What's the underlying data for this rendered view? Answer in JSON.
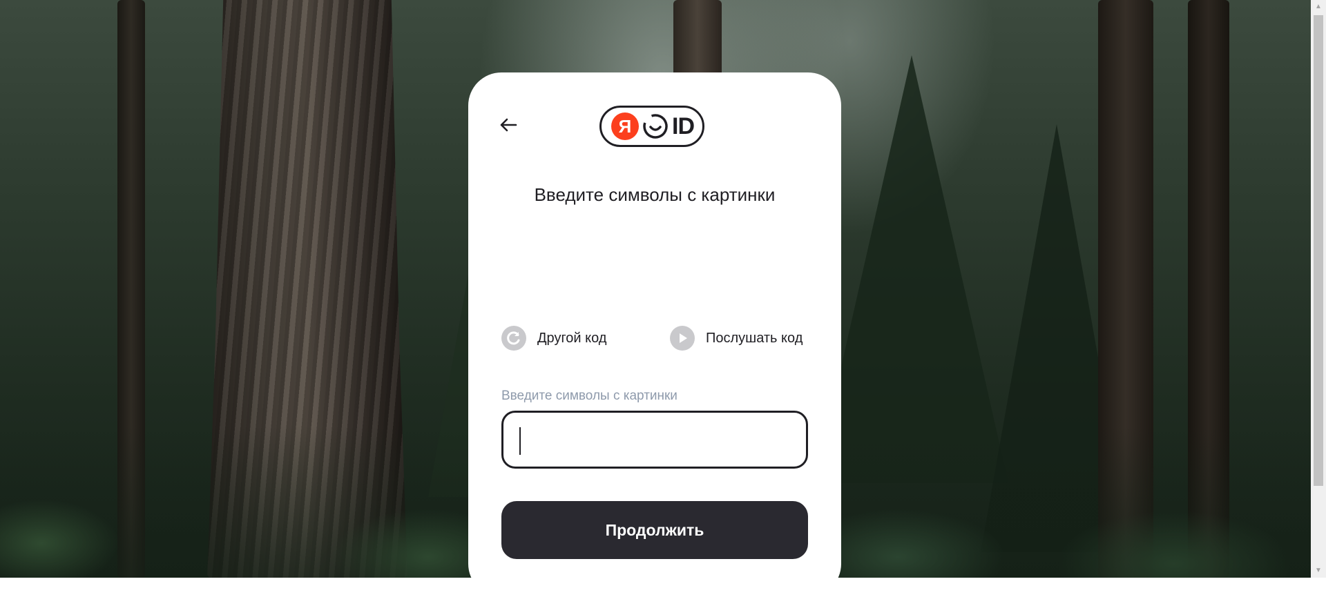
{
  "page": {
    "heading": "Введите символы с картинки"
  },
  "logo": {
    "ya_letter": "Я",
    "id_text": "ID",
    "ya_color": "#fc3f1d"
  },
  "navigation": {
    "back_icon": "arrow-left-icon"
  },
  "captcha": {
    "other_code_label": "Другой код",
    "other_code_icon": "refresh-icon",
    "listen_code_label": "Послушать код",
    "listen_code_icon": "play-icon"
  },
  "form": {
    "field_label": "Введите символы с картинки",
    "input_value": "",
    "submit_label": "Продолжить"
  },
  "colors": {
    "primary_button": "#2a2930",
    "label_muted": "#8e9aab",
    "icon_bg": "#c9c9cc"
  }
}
